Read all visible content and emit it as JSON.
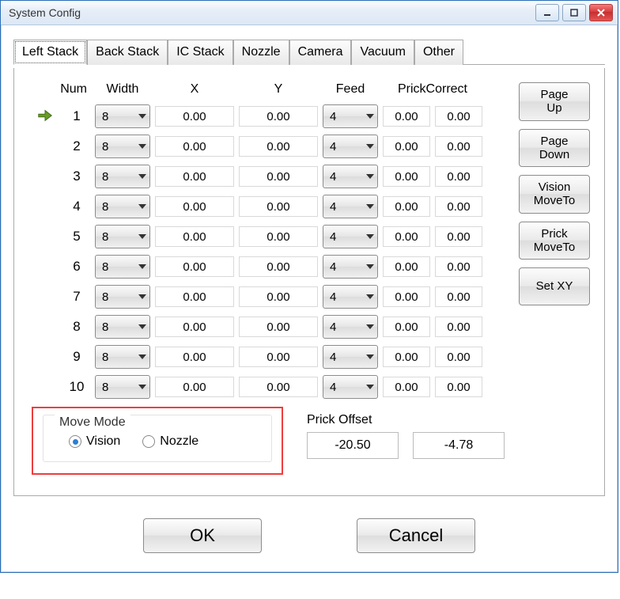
{
  "window": {
    "title": "System Config"
  },
  "tabs": [
    {
      "label": "Left Stack",
      "active": true
    },
    {
      "label": "Back Stack"
    },
    {
      "label": "IC Stack"
    },
    {
      "label": "Nozzle"
    },
    {
      "label": "Camera"
    },
    {
      "label": "Vacuum"
    },
    {
      "label": "Other"
    }
  ],
  "headers": {
    "num": "Num",
    "width": "Width",
    "x": "X",
    "y": "Y",
    "feed": "Feed",
    "prick": "PrickCorrect"
  },
  "rows": [
    {
      "num": "1",
      "width": "8",
      "x": "0.00",
      "y": "0.00",
      "feed": "4",
      "pc1": "0.00",
      "pc2": "0.00",
      "arrow": true
    },
    {
      "num": "2",
      "width": "8",
      "x": "0.00",
      "y": "0.00",
      "feed": "4",
      "pc1": "0.00",
      "pc2": "0.00"
    },
    {
      "num": "3",
      "width": "8",
      "x": "0.00",
      "y": "0.00",
      "feed": "4",
      "pc1": "0.00",
      "pc2": "0.00"
    },
    {
      "num": "4",
      "width": "8",
      "x": "0.00",
      "y": "0.00",
      "feed": "4",
      "pc1": "0.00",
      "pc2": "0.00"
    },
    {
      "num": "5",
      "width": "8",
      "x": "0.00",
      "y": "0.00",
      "feed": "4",
      "pc1": "0.00",
      "pc2": "0.00"
    },
    {
      "num": "6",
      "width": "8",
      "x": "0.00",
      "y": "0.00",
      "feed": "4",
      "pc1": "0.00",
      "pc2": "0.00"
    },
    {
      "num": "7",
      "width": "8",
      "x": "0.00",
      "y": "0.00",
      "feed": "4",
      "pc1": "0.00",
      "pc2": "0.00"
    },
    {
      "num": "8",
      "width": "8",
      "x": "0.00",
      "y": "0.00",
      "feed": "4",
      "pc1": "0.00",
      "pc2": "0.00"
    },
    {
      "num": "9",
      "width": "8",
      "x": "0.00",
      "y": "0.00",
      "feed": "4",
      "pc1": "0.00",
      "pc2": "0.00"
    },
    {
      "num": "10",
      "width": "8",
      "x": "0.00",
      "y": "0.00",
      "feed": "4",
      "pc1": "0.00",
      "pc2": "0.00"
    }
  ],
  "side_buttons": {
    "page_up": "Page\nUp",
    "page_down": "Page\nDown",
    "vision_moveto": "Vision\nMoveTo",
    "prick_moveto": "Prick\nMoveTo",
    "set_xy": "Set XY"
  },
  "move_mode": {
    "legend": "Move Mode",
    "options": {
      "vision": "Vision",
      "nozzle": "Nozzle"
    },
    "selected": "vision"
  },
  "prick_offset": {
    "label": "Prick Offset",
    "x": "-20.50",
    "y": "-4.78"
  },
  "dialog": {
    "ok": "OK",
    "cancel": "Cancel"
  }
}
